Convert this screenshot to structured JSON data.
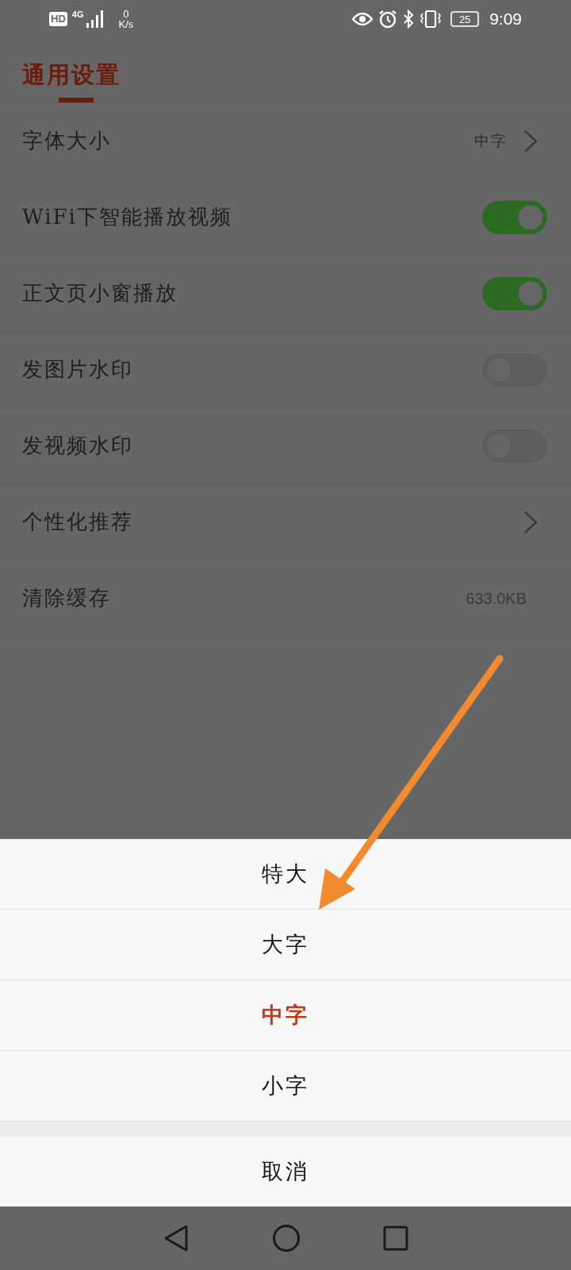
{
  "status_bar": {
    "hd": "HD",
    "network": "4G",
    "speed_value": "0",
    "speed_unit": "K/s",
    "battery": "25",
    "time": "9:09"
  },
  "header": {
    "title": "通用设置"
  },
  "settings": [
    {
      "kind": "link",
      "label": "字体大小",
      "value": "中字"
    },
    {
      "kind": "toggle",
      "label": "WiFi下智能播放视频",
      "on": true
    },
    {
      "kind": "toggle",
      "label": "正文页小窗播放",
      "on": true
    },
    {
      "kind": "toggle",
      "label": "发图片水印",
      "on": false
    },
    {
      "kind": "toggle",
      "label": "发视频水印",
      "on": false
    },
    {
      "kind": "link",
      "label": "个性化推荐"
    },
    {
      "kind": "value",
      "label": "清除缓存",
      "value": "633.0KB"
    }
  ],
  "font_size_sheet": {
    "options": [
      {
        "label": "特大",
        "selected": false
      },
      {
        "label": "大字",
        "selected": false
      },
      {
        "label": "中字",
        "selected": true
      },
      {
        "label": "小字",
        "selected": false
      }
    ],
    "cancel": "取消"
  }
}
